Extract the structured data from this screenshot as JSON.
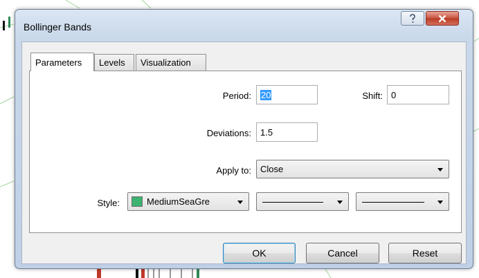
{
  "dialog": {
    "title": "Bollinger Bands",
    "help_icon": "question-mark-icon",
    "close_icon": "close-x-icon"
  },
  "tabs": [
    {
      "label": "Parameters",
      "active": true
    },
    {
      "label": "Levels",
      "active": false
    },
    {
      "label": "Visualization",
      "active": false
    }
  ],
  "parameters": {
    "period_label": "Period:",
    "period_value": "20",
    "shift_label": "Shift:",
    "shift_value": "0",
    "deviations_label": "Deviations:",
    "deviations_value": "1.5",
    "apply_to_label": "Apply to:",
    "apply_to_value": "Close",
    "style_label": "Style:",
    "style_color_name": "MediumSeaGre",
    "style_color_hex": "#3cb371"
  },
  "buttons": {
    "ok": "OK",
    "cancel": "Cancel",
    "reset": "Reset"
  }
}
